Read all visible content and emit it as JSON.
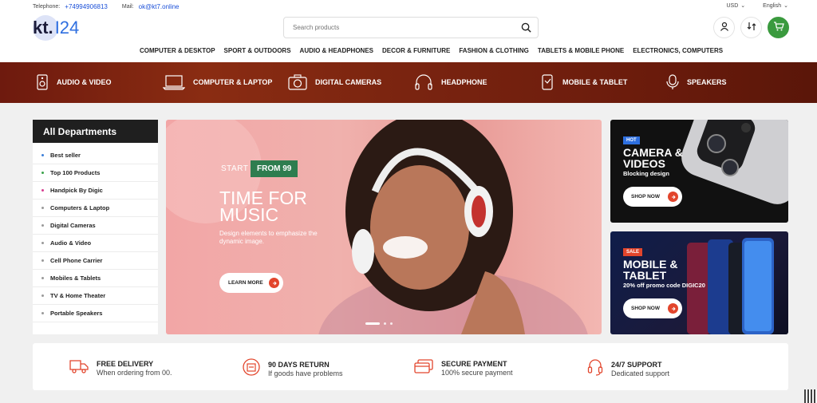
{
  "topbar": {
    "telephone_label": "Telephone:",
    "telephone": "+74994906813",
    "mail_label": "Mail:",
    "mail": "ok@kt7.online",
    "currency": "USD",
    "language": "English"
  },
  "logo": {
    "part1": "kt.",
    "part2": "I24"
  },
  "search": {
    "placeholder": "Search products"
  },
  "main_nav": [
    "COMPUTER & DESKTOP",
    "SPORT & OUTDOORS",
    "AUDIO & HEADPHONES",
    "DECOR & FURNITURE",
    "FASHION & CLOTHING",
    "TABLETS & MOBILE PHONE",
    "ELECTRONICS, COMPUTERS"
  ],
  "categories": [
    {
      "label": "AUDIO & VIDEO",
      "icon": "audio-video-icon"
    },
    {
      "label": "COMPUTER & LAPTOP",
      "icon": "laptop-icon"
    },
    {
      "label": "DIGITAL CAMERAS",
      "icon": "camera-icon"
    },
    {
      "label": "HEADPHONE",
      "icon": "headphone-icon"
    },
    {
      "label": "MOBILE & TABLET",
      "icon": "mobile-tablet-icon"
    },
    {
      "label": "SPEAKERS",
      "icon": "speaker-icon"
    }
  ],
  "departments": {
    "title": "All Departments",
    "items": [
      {
        "label": "Best seller",
        "dot": "#3c7fd9"
      },
      {
        "label": "Top 100 Products",
        "dot": "#3aa24a"
      },
      {
        "label": "Handpick By Digic",
        "dot": "#d63c8f"
      },
      {
        "label": "Computers & Laptop",
        "dot": "#999999"
      },
      {
        "label": "Digital Cameras",
        "dot": "#999999"
      },
      {
        "label": "Audio & Video",
        "dot": "#999999"
      },
      {
        "label": "Cell Phone Carrier",
        "dot": "#999999"
      },
      {
        "label": "Mobiles & Tablets",
        "dot": "#999999"
      },
      {
        "label": "TV & Home Theater",
        "dot": "#999999"
      },
      {
        "label": "Portable Speakers",
        "dot": "#999999"
      }
    ]
  },
  "hero": {
    "start": "START",
    "badge": "FROM 99",
    "title": "TIME FOR MUSIC",
    "desc": "Design elements to emphasize the dynamic image.",
    "button": "LEARN MORE"
  },
  "promos": [
    {
      "tag": "HOT",
      "tag_color": "#2d6fe0",
      "title": "CAMERA & VIDEOS",
      "subtitle": "Blocking design",
      "button": "SHOP NOW"
    },
    {
      "tag": "SALE",
      "tag_color": "#e2452c",
      "title": "MOBILE & TABLET",
      "subtitle": "20% off promo code DIGIC20",
      "button": "SHOP NOW"
    }
  ],
  "features": [
    {
      "title": "FREE DELIVERY",
      "subtitle": "When ordering from 00.",
      "icon": "truck-icon"
    },
    {
      "title": "90 DAYS RETURN",
      "subtitle": "If goods have problems",
      "icon": "return-box-icon"
    },
    {
      "title": "SECURE PAYMENT",
      "subtitle": "100% secure payment",
      "icon": "credit-card-icon"
    },
    {
      "title": "24/7 SUPPORT",
      "subtitle": "Dedicated support",
      "icon": "support-headset-icon"
    }
  ],
  "colors": {
    "accent": "#e2452c",
    "brand_blue": "#2f6fe0",
    "cart_green": "#3a9a3e",
    "badge_green": "#2e7d4f"
  }
}
